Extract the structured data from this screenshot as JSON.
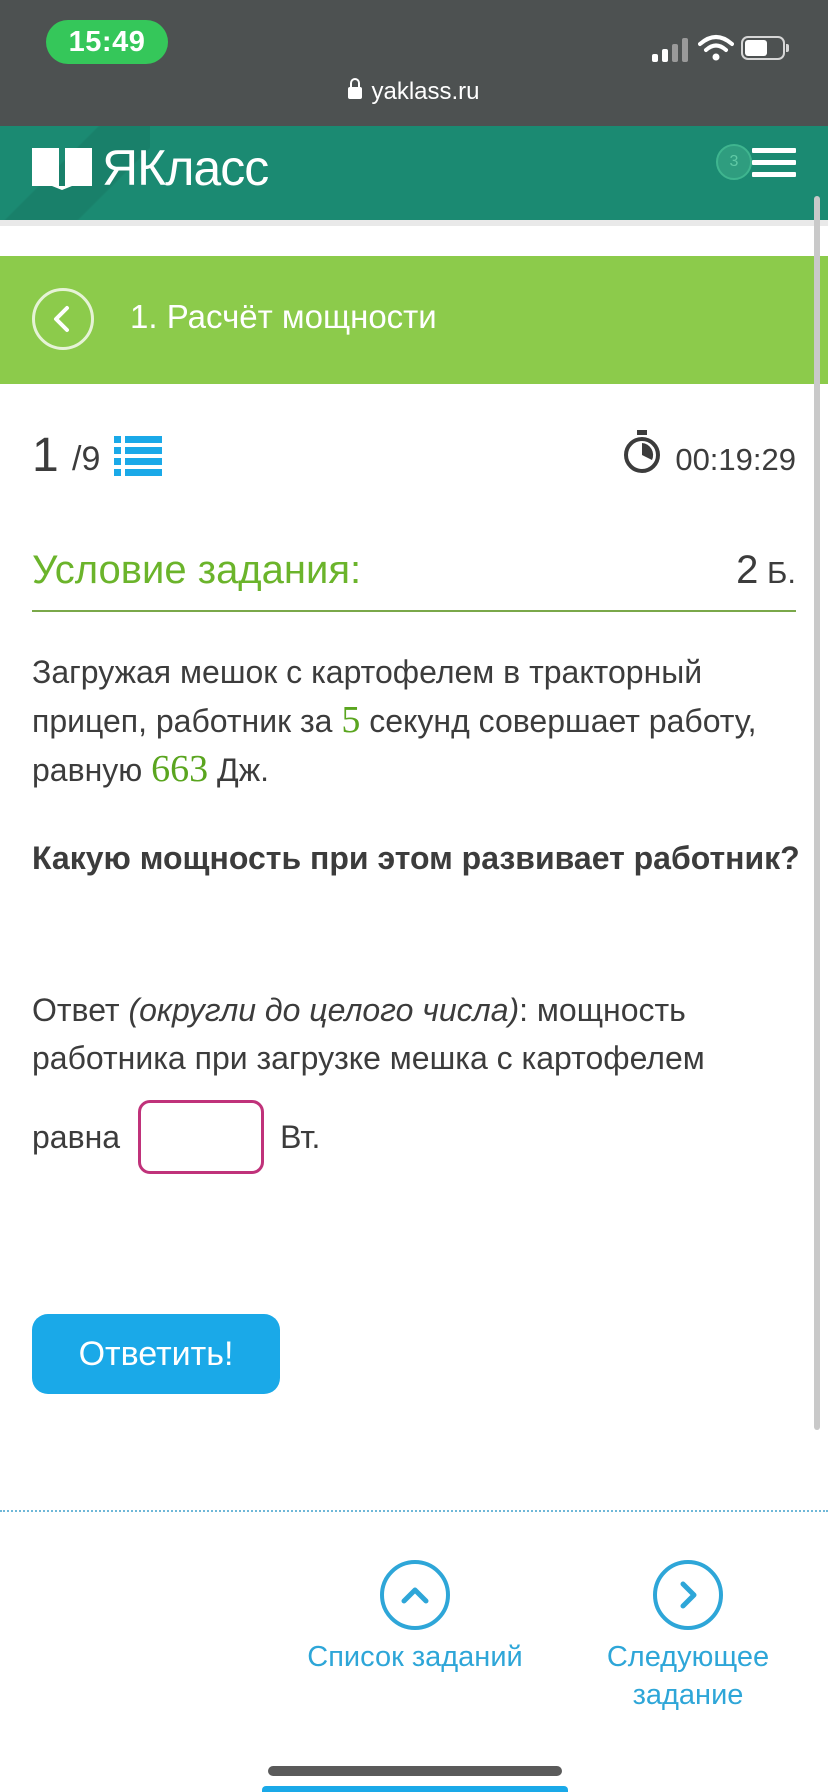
{
  "status_bar": {
    "time": "15:49",
    "url": "yaklass.ru"
  },
  "header": {
    "logo_text": "ЯКласс",
    "notification_count": "3"
  },
  "topic": {
    "title": "1. Расчёт мощности"
  },
  "progress": {
    "current": "1",
    "total": "/9",
    "timer": "00:19:29"
  },
  "condition": {
    "title": "Условие задания:",
    "points": "2",
    "points_unit": " Б."
  },
  "task": {
    "p1": "Загружая мешок с картофелем в тракторный прицеп, работник за ",
    "num1": "5",
    "p2": " секунд совершает работу, равную ",
    "num2": "663",
    "p3": " Дж.",
    "question": "Какую мощность при этом развивает работник?"
  },
  "answer": {
    "prefix": "Ответ ",
    "hint": "(округли до целого числа)",
    "text": ": мощность работника при загрузке мешка с картофелем",
    "equals": "равна",
    "value": "",
    "unit": "Вт."
  },
  "submit_label": "Ответить!",
  "bottom_nav": {
    "list_label": "Список заданий",
    "next_label_1": "Следующее",
    "next_label_2": "задание"
  },
  "colors": {
    "header_bg": "#1b8a72",
    "topic_bg": "#8ccb4b",
    "accent_green": "#6bb42b",
    "button_blue": "#1aa9e8",
    "input_border": "#c0327a"
  }
}
